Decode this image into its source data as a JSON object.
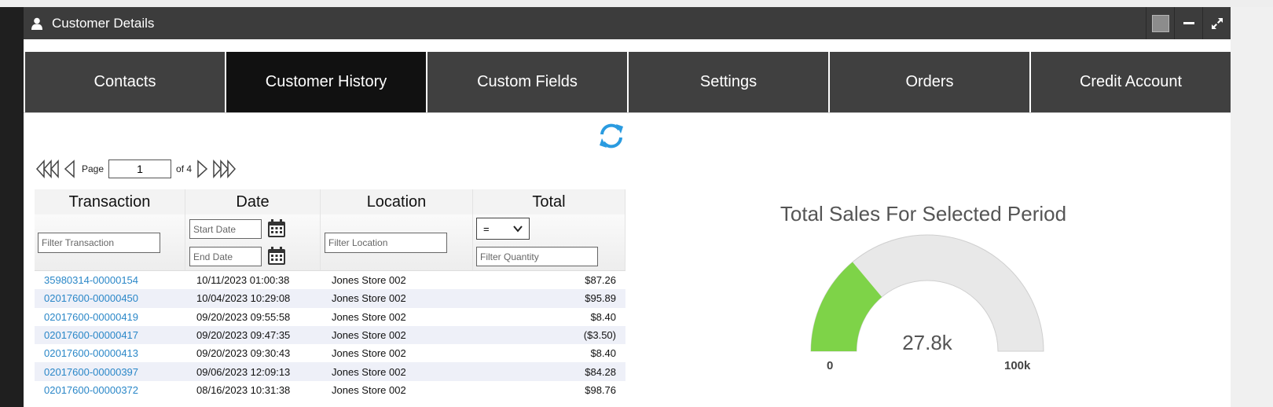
{
  "window": {
    "title": "Customer Details"
  },
  "tabs": [
    {
      "label": "Contacts",
      "active": false
    },
    {
      "label": "Customer History",
      "active": true
    },
    {
      "label": "Custom Fields",
      "active": false
    },
    {
      "label": "Settings",
      "active": false
    },
    {
      "label": "Orders",
      "active": false
    },
    {
      "label": "Credit Account",
      "active": false
    }
  ],
  "pager": {
    "page_label": "Page",
    "page_value": "1",
    "of_label": "of 4"
  },
  "grid": {
    "columns": [
      "Transaction",
      "Date",
      "Location",
      "Total"
    ],
    "filters": {
      "transaction_placeholder": "Filter Transaction",
      "start_date_placeholder": "Start Date",
      "end_date_placeholder": "End Date",
      "location_placeholder": "Filter Location",
      "operator": "=",
      "quantity_placeholder": "Filter Quantity"
    },
    "rows": [
      {
        "transaction": "35980314-00000154",
        "date": "10/11/2023 01:00:38",
        "location": "Jones Store 002",
        "total": "$87.26"
      },
      {
        "transaction": "02017600-00000450",
        "date": "10/04/2023 10:29:08",
        "location": "Jones Store 002",
        "total": "$95.89"
      },
      {
        "transaction": "02017600-00000419",
        "date": "09/20/2023 09:55:58",
        "location": "Jones Store 002",
        "total": "$8.40"
      },
      {
        "transaction": "02017600-00000417",
        "date": "09/20/2023 09:47:35",
        "location": "Jones Store 002",
        "total": "($3.50)"
      },
      {
        "transaction": "02017600-00000413",
        "date": "09/20/2023 09:30:43",
        "location": "Jones Store 002",
        "total": "$8.40"
      },
      {
        "transaction": "02017600-00000397",
        "date": "09/06/2023 12:09:13",
        "location": "Jones Store 002",
        "total": "$84.28"
      },
      {
        "transaction": "02017600-00000372",
        "date": "08/16/2023 10:31:38",
        "location": "Jones Store 002",
        "total": "$98.76"
      }
    ]
  },
  "gauge": {
    "title": "Total Sales For Selected Period",
    "value_label": "27.8k",
    "min_label": "0",
    "max_label": "100k",
    "value": 27800,
    "min": 0,
    "max": 100000,
    "fill_color": "#7ed348",
    "track_color": "#e8e8e8"
  },
  "colors": {
    "titlebar": "#3c3c3c",
    "tab": "#404040",
    "tab_active": "#111111",
    "link": "#2a87c8",
    "refresh": "#2a9be0"
  }
}
